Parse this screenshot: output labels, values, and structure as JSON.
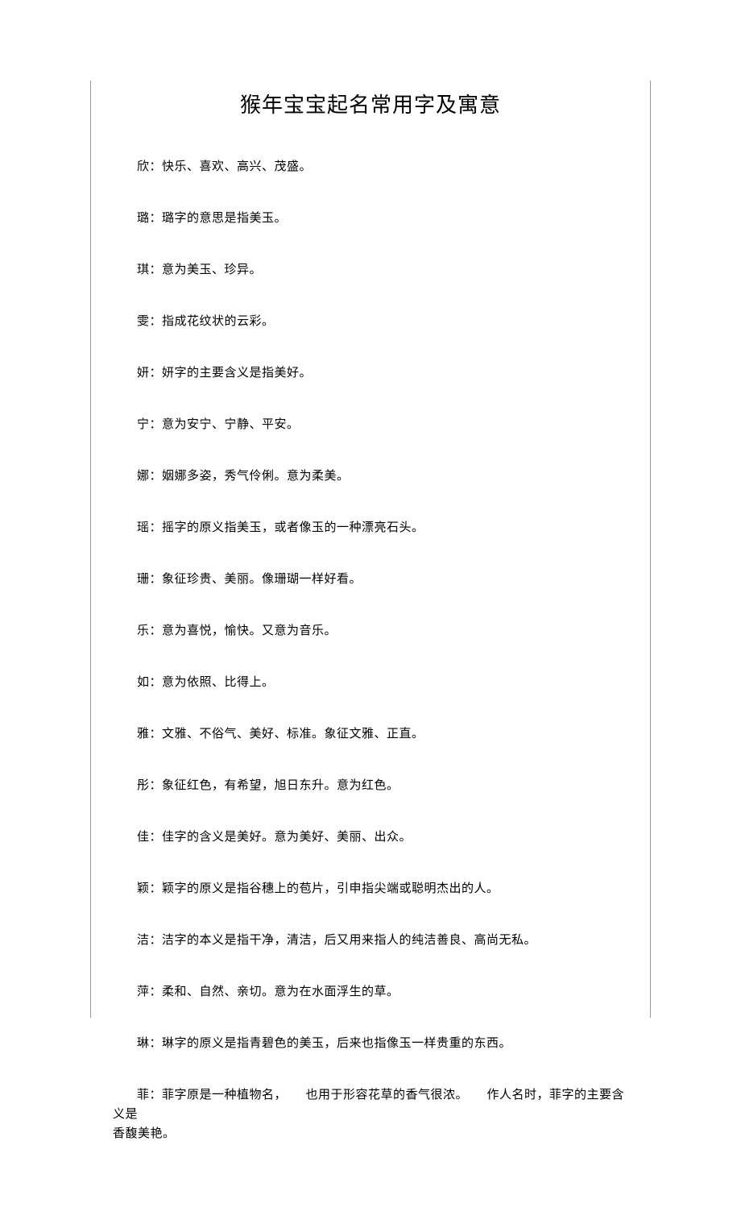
{
  "title": "猴年宝宝起名常用字及寓意",
  "entries": [
    "欣：快乐、喜欢、高兴、茂盛。",
    "璐：璐字的意思是指美玉。",
    "琪：意为美玉、珍异。",
    "雯：指成花纹状的云彩。",
    "妍：妍字的主要含义是指美好。",
    "宁：意为安宁、宁静、平安。",
    "娜：姻娜多姿，秀气伶俐。意为柔美。",
    "瑶：摇字的原义指美玉，或者像玉的一种漂亮石头。",
    "珊：象征珍贵、美丽。像珊瑚一样好看。",
    "乐：意为喜悦，愉快。又意为音乐。",
    "如：意为依照、比得上。",
    "雅：文雅、不俗气、美好、标准。象征文雅、正直。",
    "彤：象征红色，有希望，旭日东升。意为红色。",
    "佳：佳字的含义是美好。意为美好、美丽、出众。",
    "颖：颖字的原义是指谷穗上的苞片，引申指尖端或聪明杰出的人。",
    "洁：洁字的本义是指干净，清洁，后又用来指人的纯洁善良、高尚无私。",
    "萍：柔和、自然、亲切。意为在水面浮生的草。",
    "琳：琳字的原义是指青碧色的美玉，后来也指像玉一样贵重的东西。"
  ],
  "last_entry": {
    "line1": "菲：菲字原是一种植物名，　　也用于形容花草的香气很浓。　　作人名时，菲字的主要含义是",
    "line2": "香馥美艳。"
  }
}
